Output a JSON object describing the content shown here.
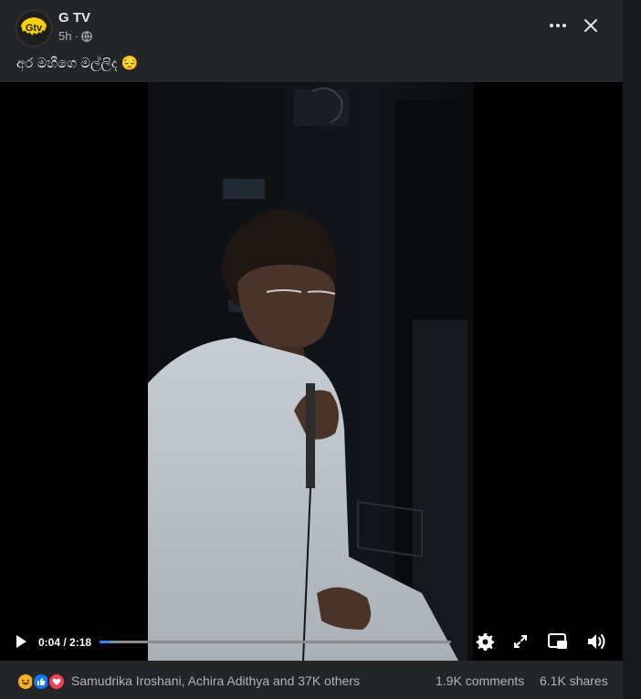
{
  "post": {
    "page_name": "G TV",
    "time_ago": "5h",
    "separator": "·",
    "audience_icon": "globe-icon",
    "caption": "අර මහීගෙ මල්ලිද 😔",
    "more_label": "•••"
  },
  "video": {
    "current_time": "0:04",
    "duration": "2:18",
    "time_display": "0:04 / 2:18",
    "progress": 0.03
  },
  "footer": {
    "reaction_icons": [
      "haha-icon",
      "like-icon",
      "love-icon"
    ],
    "reactors_text": "Samudrika Iroshani, Achira Adithya and 37K others",
    "comments": "1.9K comments",
    "shares": "6.1K shares"
  },
  "colors": {
    "background": "#242526",
    "text": "#e4e6eb",
    "secondary_text": "#b0b3b8",
    "progress": "#2d88ff",
    "like": "#1877f2",
    "love": "#f33e58",
    "haha": "#f7b125"
  }
}
